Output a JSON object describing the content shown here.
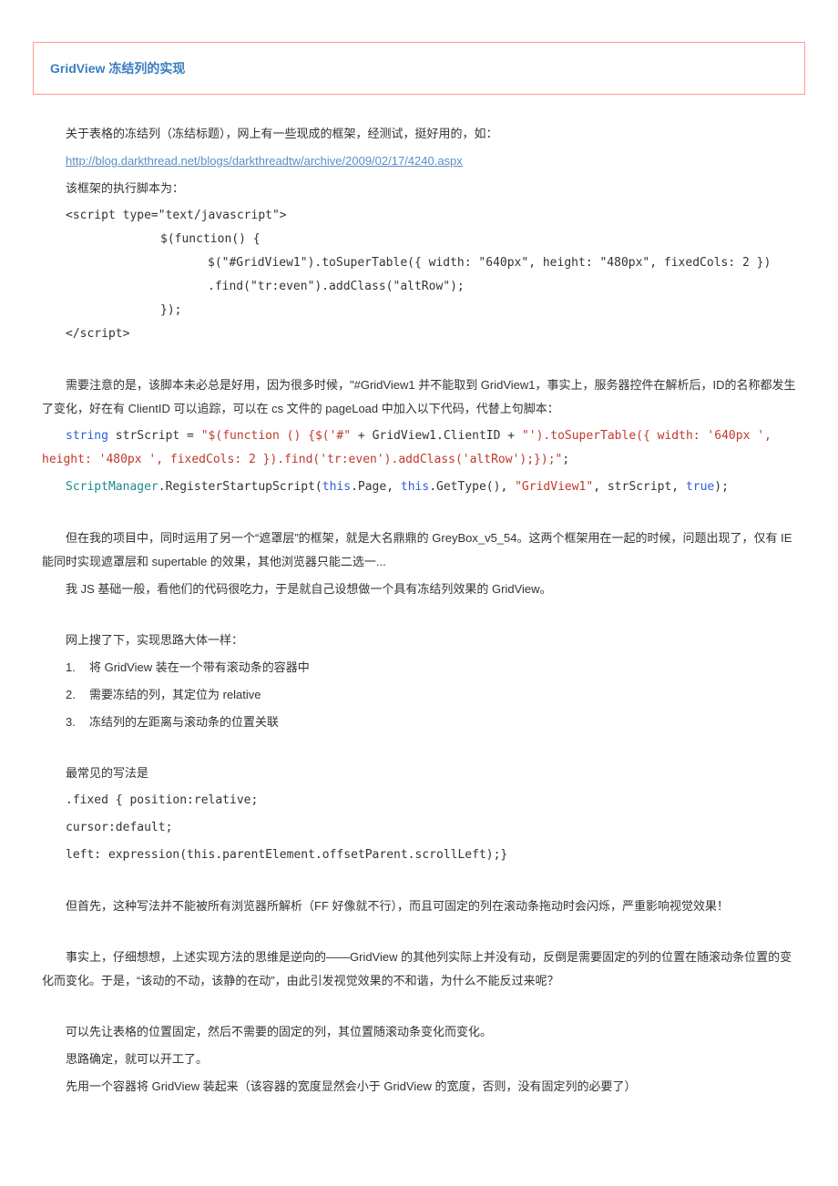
{
  "title": "GridView 冻结列的实现",
  "intro": "关于表格的冻结列（冻结标题），网上有一些现成的框架，经测试，挺好用的，如：",
  "link": "http://blog.darkthread.net/blogs/darkthreadtw/archive/2009/02/17/4240.aspx",
  "frame_script_label": "该框架的执行脚本为：",
  "script1": {
    "open": "<script type=\"text/javascript\">",
    "l1": "$(function() {",
    "l2": "$(\"#GridView1\").toSuperTable({ width: \"640px\", height: \"480px\", fixedCols: 2 })",
    "l3": ".find(\"tr:even\").addClass(\"altRow\");",
    "l4": "});",
    "close": "</script>"
  },
  "note1": "需要注意的是，该脚本未必总是好用，因为很多时候，\"#GridView1 并不能取到 GridView1，事实上，服务器控件在解析后，ID的名称都发生了变化，好在有 ClientID 可以追踪，可以在 cs 文件的 pageLoad 中加入以下代码，代替上句脚本：",
  "cs1": {
    "kw1": "string",
    "var1": "  strScript = ",
    "s1": "\"$(function () {$('#\"",
    "mid1": "  + GridView1.ClientID + ",
    "s2": " \"').toSuperTable({ width: '640px ', height: '480px ', fixedCols: 2 }).find('tr:even').addClass('altRow');});\"",
    "end": ";"
  },
  "cs2": {
    "cls": "ScriptManager",
    "m1": ".RegisterStartupScript(",
    "kw_this1": "this",
    "m2": ".Page,   ",
    "kw_this2": "this",
    "m3": ".GetType(),  ",
    "s1": "\"GridView1\"",
    "m4": ", strScript,  ",
    "kw_true": "true",
    "m5": ");"
  },
  "para2": "但在我的项目中，同时运用了另一个“遮罩层”的框架，就是大名鼎鼎的 GreyBox_v5_54。这两个框架用在一起的时候，问题出现了，仅有 IE 能同时实现遮罩层和 supertable 的效果，其他浏览器只能二选一...",
  "para3": "我 JS 基础一般，看他们的代码很吃力，于是就自己设想做一个具有冻结列效果的 GridView。",
  "para4": "网上搜了下，实现思路大体一样：",
  "steps": [
    "将 GridView 装在一个带有滚动条的容器中",
    "需要冻结的列，其定位为 relative",
    "冻结列的左距离与滚动条的位置关联"
  ],
  "para5": "最常见的写法是",
  "css1": ".fixed { position:relative;",
  "css2": "cursor:default;",
  "css3": "left: expression(this.parentElement.offsetParent.scrollLeft);}",
  "para6": "但首先，这种写法并不能被所有浏览器所解析（FF 好像就不行），而且可固定的列在滚动条拖动时会闪烁，严重影响视觉效果！",
  "para7": "事实上，仔细想想，上述实现方法的思维是逆向的——GridView 的其他列实际上并没有动，反倒是需要固定的列的位置在随滚动条位置的变化而变化。于是，“该动的不动，该静的在动”，由此引发视觉效果的不和谐，为什么不能反过来呢？",
  "para8": "可以先让表格的位置固定，然后不需要的固定的列，其位置随滚动条变化而变化。",
  "para9": "思路确定，就可以开工了。",
  "para10": "先用一个容器将 GridView 装起来（该容器的宽度显然会小于 GridView 的宽度，否则，没有固定列的必要了）"
}
